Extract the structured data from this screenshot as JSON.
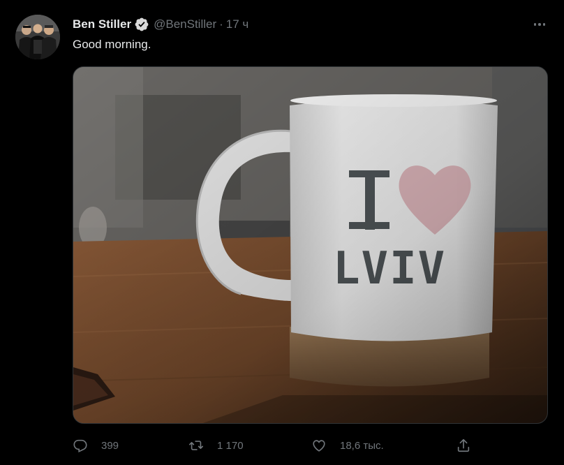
{
  "tweet": {
    "display_name": "Ben Stiller",
    "verified": true,
    "handle": "@BenStiller",
    "separator": "·",
    "time": "17 ч",
    "text": "Good morning.",
    "photo": {
      "mug_line1": "I",
      "mug_line2": "LVIV"
    }
  },
  "actions": {
    "reply_count": "399",
    "retweet_count": "1 170",
    "like_count": "18,6 тыс."
  },
  "colors": {
    "background": "#000000",
    "text_primary": "#e7e9ea",
    "text_secondary": "#71767b",
    "verified_badge": "#d9d9d9"
  }
}
